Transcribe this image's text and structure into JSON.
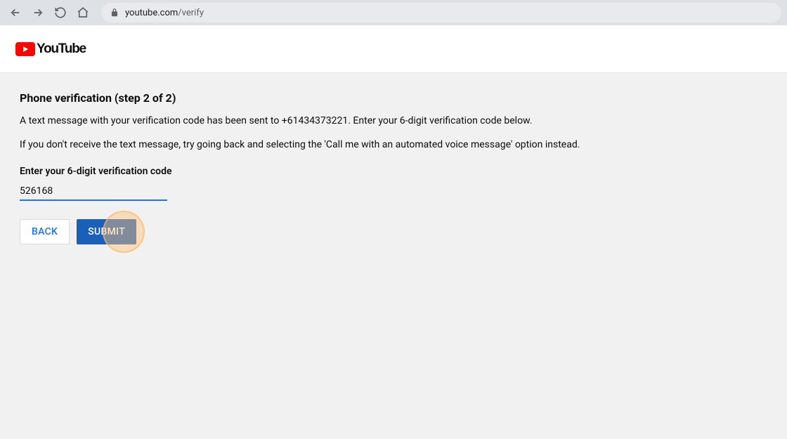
{
  "browser": {
    "url_domain": "youtube.com",
    "url_path": "/verify"
  },
  "header": {
    "logo_text": "YouTube"
  },
  "content": {
    "title": "Phone verification (step 2 of 2)",
    "sent_message": "A text message with your verification code has been sent to +61434373221. Enter your 6-digit verification code below.",
    "fallback_message": "If you don't receive the text message, try going back and selecting the 'Call me with an automated voice message' option instead.",
    "input_label": "Enter your 6-digit verification code",
    "code_value": "526168",
    "back_button": "Back",
    "submit_button": "Submit"
  }
}
